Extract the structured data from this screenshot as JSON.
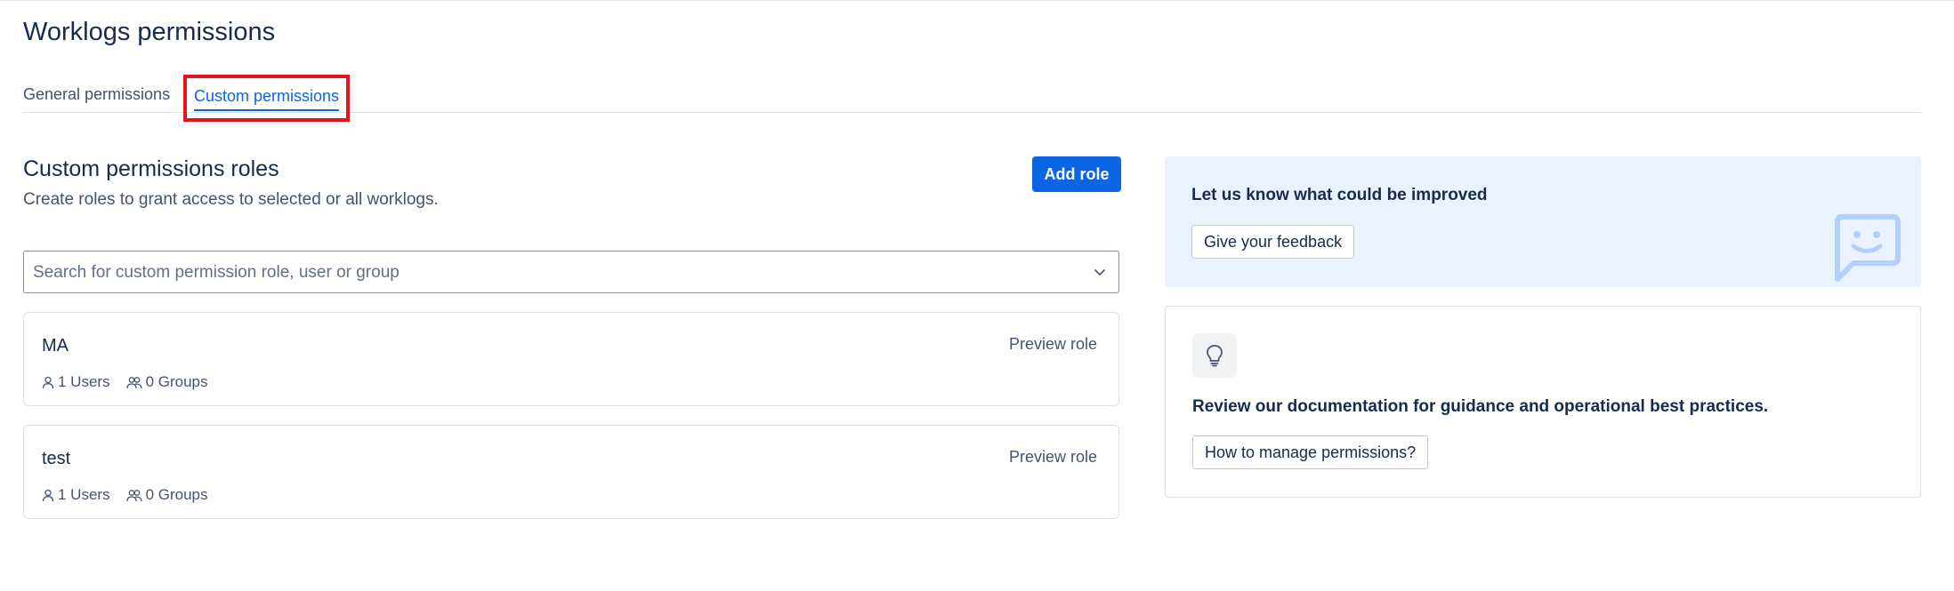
{
  "page": {
    "title": "Worklogs permissions"
  },
  "tabs": [
    {
      "label": "General permissions",
      "selected": false
    },
    {
      "label": "Custom permissions",
      "selected": true
    }
  ],
  "roles_section": {
    "title": "Custom permissions roles",
    "description": "Create roles to grant access to selected or all worklogs.",
    "add_button_label": "Add role",
    "search_placeholder": "Search for custom permission role, user or group"
  },
  "roles": [
    {
      "name": "MA",
      "action_label": "Preview role",
      "users": "1 Users",
      "groups": "0 Groups"
    },
    {
      "name": "test",
      "action_label": "Preview role",
      "users": "1 Users",
      "groups": "0 Groups"
    }
  ],
  "feedback": {
    "title": "Let us know what could be improved",
    "button_label": "Give your feedback",
    "icon": "smiley-chat-icon"
  },
  "documentation": {
    "icon": "lightbulb-icon",
    "text": "Review our documentation for guidance and operational best practices.",
    "button_label": "How to manage permissions?"
  },
  "colors": {
    "primary": "#0c66e4",
    "highlight_border": "#e3141e",
    "feedback_bg": "#e9f2ff",
    "smiley": "#b3d0fa"
  }
}
